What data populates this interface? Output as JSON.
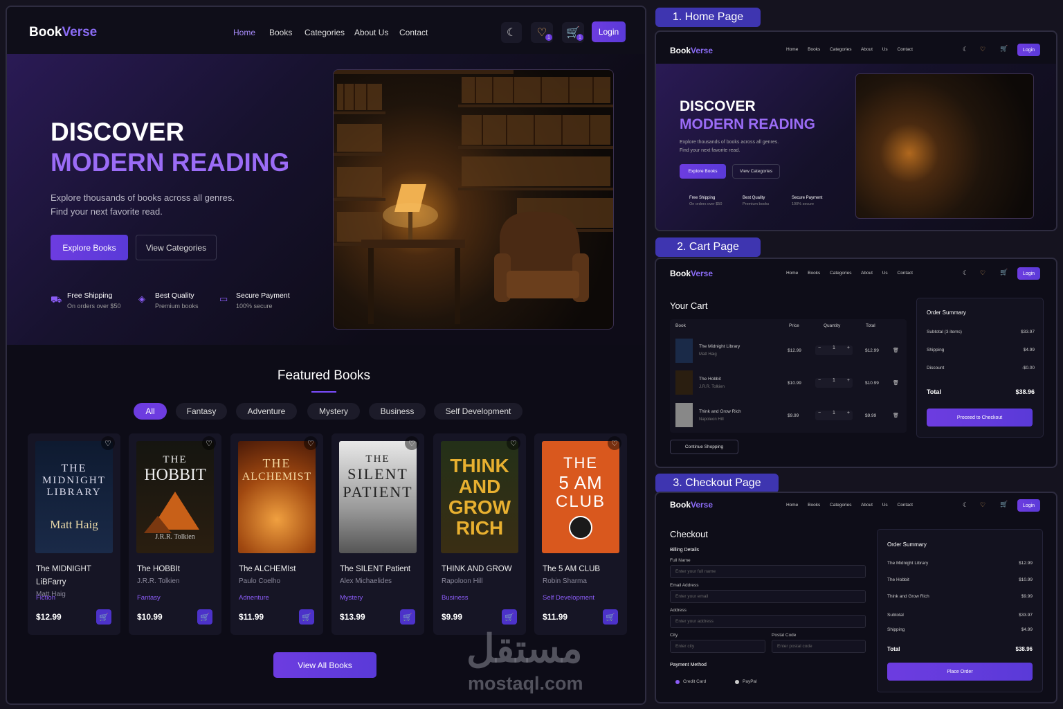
{
  "brand": {
    "name_a": "Book",
    "name_b": "Verse"
  },
  "nav": {
    "home": "Home",
    "books": "Books",
    "categories": "Categories",
    "about": "About Us",
    "contact": "Contact",
    "login": "Login",
    "wishlist_count": "1",
    "cart_count": "1"
  },
  "hero": {
    "title1": "DISCOVER",
    "title2": "MODERN READING",
    "sub1": "Explore thousands of books across all genres.",
    "sub2": "Find your next favorite read.",
    "explore": "Explore Books",
    "view_categories": "View Categories",
    "features": [
      {
        "title": "Free Shipping",
        "sub": "On orders over $50"
      },
      {
        "title": "Best Quality",
        "sub": "Premium books"
      },
      {
        "title": "Secure Payment",
        "sub": "100% secure"
      }
    ]
  },
  "featured": {
    "title": "Featured Books",
    "filters": [
      "All",
      "Fantasy",
      "Adventure",
      "Mystery",
      "Business",
      "Self Development"
    ],
    "books": [
      {
        "cover1": "THE",
        "cover2": "MIDNIGHT",
        "cover3": "LIBRARY",
        "cover4": "Matt Haig",
        "title": "The MIDNIGHT LiBFarry",
        "author": "Matt Haig",
        "category": "Fiction",
        "price": "$12.99"
      },
      {
        "cover1": "THE",
        "cover2": "HOBBIT",
        "cover3": "",
        "cover4": "J.R.R. Tolkien",
        "title": "The HOBBIt",
        "author": "J.R.R. Tolkien",
        "category": "Fantasy",
        "price": "$10.99"
      },
      {
        "cover1": "THE",
        "cover2": "ALCHEMIST",
        "cover3": "",
        "cover4": "",
        "title": "The ALCHEMIst",
        "author": "Paulo Coelho",
        "category": "Adnenture",
        "price": "$11.99"
      },
      {
        "cover1": "THE",
        "cover2": "SILENT",
        "cover3": "PATIENT",
        "cover4": "",
        "title": "The SILENT Patient",
        "author": "Alex Michaelides",
        "category": "Mystery",
        "price": "$13.99"
      },
      {
        "cover1": "THINK",
        "cover2": "AND",
        "cover3": "GROW",
        "cover4": "RICH",
        "title": "THINK AND GROW",
        "author": "Rapoloon Hill",
        "category": "Business",
        "price": "$9.99"
      },
      {
        "cover1": "THE",
        "cover2": "5 AM",
        "cover3": "CLUB",
        "cover4": "",
        "title": "The 5 AM CLUB",
        "author": "Robin Sharma",
        "category": "Self Development",
        "price": "$11.99"
      }
    ],
    "view_all": "View All Books"
  },
  "labels": {
    "home_page": "1. Home Page",
    "cart_page": "2. Cart Page",
    "checkout_page": "3. Checkout Page"
  },
  "cart": {
    "title": "Your Cart",
    "headers": [
      "Book",
      "Price",
      "Quantity",
      "Total"
    ],
    "items": [
      {
        "title": "The Midnight Library",
        "author": "Matt Haig",
        "price": "$12.99",
        "qty": "1",
        "total": "$12.99"
      },
      {
        "title": "The Hobbit",
        "author": "J.R.R. Tolkien",
        "price": "$10.99",
        "qty": "1",
        "total": "$10.99"
      },
      {
        "title": "Think and Grow Rich",
        "author": "Napoleon Hill",
        "price": "$9.99",
        "qty": "1",
        "total": "$9.99"
      }
    ],
    "continue": "Continue Shopping",
    "summary": {
      "title": "Order Summary",
      "subtotal_label": "Subtotal (3 items)",
      "subtotal": "$33.97",
      "shipping_label": "Shipping",
      "shipping": "$4.99",
      "discount_label": "Discount",
      "discount": "-$0.00",
      "total_label": "Total",
      "total": "$38.96",
      "checkout": "Proceed to Checkout"
    }
  },
  "checkout": {
    "title": "Checkout",
    "billing": "Billing Details",
    "full_name": "Full Name",
    "full_name_ph": "Enter your full name",
    "email": "Email Address",
    "email_ph": "Enter your email",
    "address": "Address",
    "address_ph": "Enter your address",
    "city": "City",
    "city_ph": "Enter city",
    "postal": "Postal Code",
    "postal_ph": "Enter postal code",
    "payment": "Payment Method",
    "card": "Credit Card",
    "paypal": "PayPal",
    "summary": {
      "title": "Order Summary",
      "i1": "The Midnight Library",
      "p1": "$12.99",
      "i2": "The Hobbit",
      "p2": "$10.99",
      "i3": "Think and Grow Rich",
      "p3": "$9.99",
      "subtotal_label": "Subtotal",
      "subtotal": "$33.97",
      "shipping_label": "Shipping",
      "shipping": "$4.99",
      "total_label": "Total",
      "total": "$38.96",
      "place": "Place Order"
    }
  },
  "watermark": {
    "arabic": "مستقل",
    "latin": "mostaql.com"
  }
}
